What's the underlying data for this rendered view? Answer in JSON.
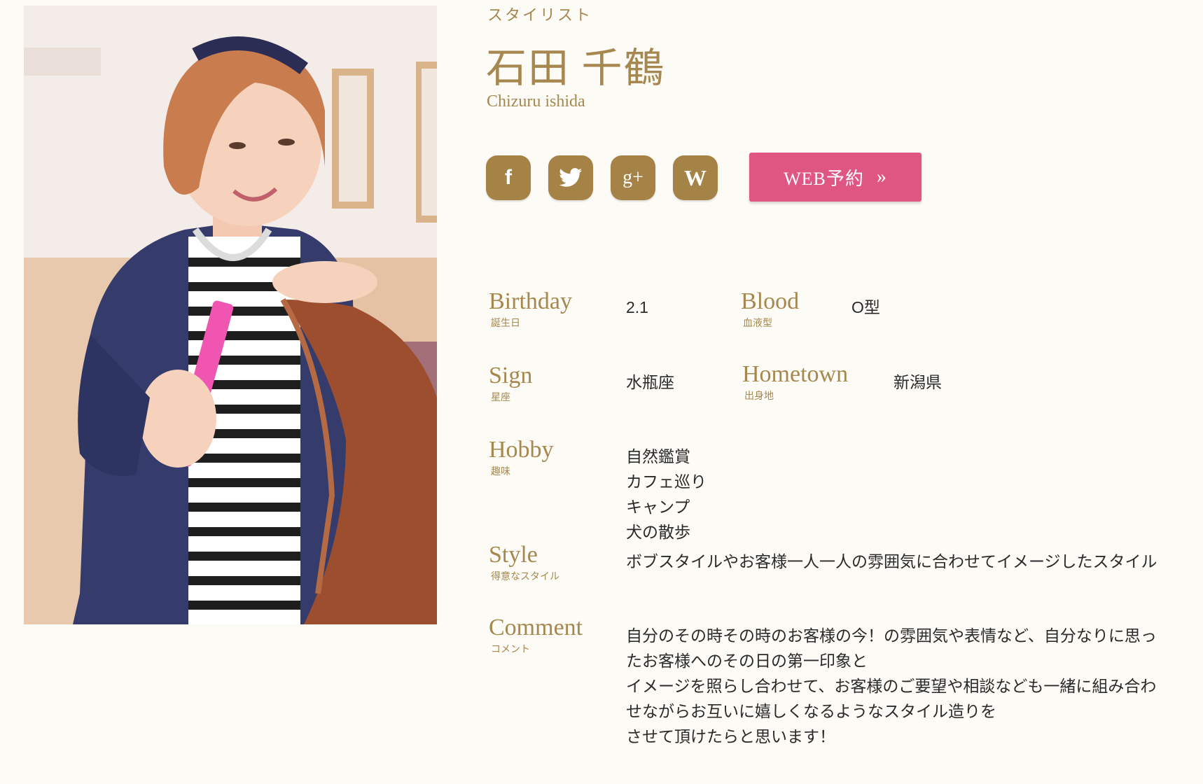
{
  "stylist": {
    "role": "スタイリスト",
    "name": "石田 千鶴",
    "name_roman": "Chizuru ishida"
  },
  "social": [
    {
      "name": "facebook",
      "icon": "facebook-icon",
      "glyph": "f"
    },
    {
      "name": "twitter",
      "icon": "twitter-icon",
      "glyph": ""
    },
    {
      "name": "google-plus",
      "icon": "google-plus-icon",
      "glyph": "g+"
    },
    {
      "name": "wordpress",
      "icon": "wordpress-icon",
      "glyph": "W"
    }
  ],
  "web_reserve": {
    "label": "WEB予約",
    "arrow": "»"
  },
  "profile": {
    "birthday": {
      "label_en": "Birthday",
      "label_jp": "誕生日",
      "value": "2.1"
    },
    "blood": {
      "label_en": "Blood",
      "label_jp": "血液型",
      "value": "O型"
    },
    "sign": {
      "label_en": "Sign",
      "label_jp": "星座",
      "value": "水瓶座"
    },
    "hometown": {
      "label_en": "Hometown",
      "label_jp": "出身地",
      "value": "新潟県"
    },
    "hobby": {
      "label_en": "Hobby",
      "label_jp": "趣味",
      "values": [
        "自然鑑賞",
        "カフェ巡り",
        "キャンプ",
        "犬の散歩"
      ]
    },
    "style": {
      "label_en": "Style",
      "label_jp": "得意なスタイル",
      "value": "ボブスタイルやお客様一人一人の雰囲気に合わせてイメージしたスタイル"
    },
    "comment": {
      "label_en": "Comment",
      "label_jp": "コメント",
      "lines": [
        "自分のその時その時のお客様の今！の雰囲気や表情など、自分なりに思っ",
        "たお客様へのその日の第一印象と",
        "イメージを照らし合わせて、お客様のご要望や相談なども一緒に組み合わ",
        "せながらお互いに嬉しくなるようなスタイル造りを",
        "させて頂けたらと思います！"
      ]
    }
  },
  "colors": {
    "accent_gold": "#a5874f",
    "icon_bg": "#a58346",
    "reserve_pink": "#e05683",
    "page_bg": "#fdfbf5"
  }
}
